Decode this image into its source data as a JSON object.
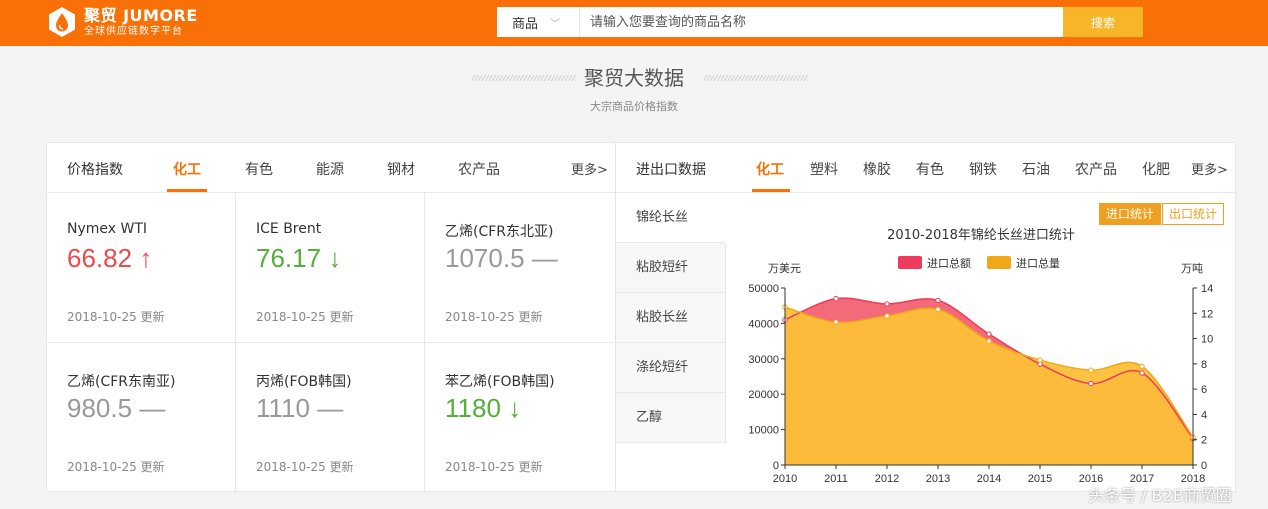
{
  "header": {
    "logo_name": "聚贸 JUMORE",
    "logo_slogan": "全球供应链数字平台",
    "search_category": "商品",
    "search_placeholder": "请输入您要查询的商品名称",
    "search_button": "搜索"
  },
  "section": {
    "title": "聚贸大数据",
    "subtitle": "大宗商品价格指数"
  },
  "price_panel": {
    "title": "价格指数",
    "tabs": [
      "化工",
      "有色",
      "能源",
      "钢材",
      "农产品"
    ],
    "active_tab": "化工",
    "more": "更多>",
    "items": [
      {
        "name": "Nymex WTI",
        "value": "66.82",
        "arrow": "↑",
        "trend": "up",
        "date": "2018-10-25 更新"
      },
      {
        "name": "ICE Brent",
        "value": "76.17",
        "arrow": "↓",
        "trend": "down",
        "date": "2018-10-25 更新"
      },
      {
        "name": "乙烯(CFR东北亚)",
        "value": "1070.5",
        "arrow": "—",
        "trend": "flat",
        "date": "2018-10-25 更新"
      },
      {
        "name": "乙烯(CFR东南亚)",
        "value": "980.5",
        "arrow": "—",
        "trend": "flat",
        "date": "2018-10-25 更新"
      },
      {
        "name": "丙烯(FOB韩国)",
        "value": "1110",
        "arrow": "—",
        "trend": "flat",
        "date": "2018-10-25 更新"
      },
      {
        "name": "苯乙烯(FOB韩国)",
        "value": "1180",
        "arrow": "↓",
        "trend": "down",
        "date": "2018-10-25 更新"
      }
    ]
  },
  "trade_panel": {
    "title": "进出口数据",
    "tabs": [
      "化工",
      "塑料",
      "橡胶",
      "有色",
      "钢铁",
      "石油",
      "农产品",
      "化肥"
    ],
    "active_tab": "化工",
    "more": "更多>",
    "side_items": [
      "锦纶长丝",
      "粘胶短纤",
      "粘胶长丝",
      "涤纶短纤",
      "乙醇"
    ],
    "active_side": "锦纶长丝",
    "toggle_import": "进口统计",
    "toggle_export": "出口统计",
    "toggle_active": "进口统计"
  },
  "chart_data": {
    "type": "area",
    "title": "2010-2018年锦纶长丝进口统计",
    "x": [
      "2010",
      "2011",
      "2012",
      "2013",
      "2014",
      "2015",
      "2016",
      "2017",
      "2018"
    ],
    "series": [
      {
        "name": "进口总额",
        "axis": "left",
        "color": "#ee3b5b",
        "values": [
          41000,
          47000,
          45500,
          46500,
          37000,
          28500,
          23000,
          26000,
          7500
        ]
      },
      {
        "name": "进口总量",
        "axis": "right",
        "color": "#f0a81a",
        "values": [
          12.5,
          11.3,
          11.8,
          12.3,
          9.8,
          8.3,
          7.5,
          7.8,
          2.2
        ]
      }
    ],
    "ylabel_left": "万美元",
    "ylabel_right": "万吨",
    "ylim_left": [
      0,
      50000
    ],
    "ylim_right": [
      0,
      14
    ],
    "yticks_left": [
      0,
      10000,
      20000,
      30000,
      40000,
      50000
    ],
    "yticks_right": [
      0,
      2,
      4,
      6,
      8,
      10,
      12,
      14
    ],
    "legend": "top"
  },
  "watermark": "头条号 / B2B商贸圈",
  "colors": {
    "brand": "#f97007",
    "search_button": "#f7b52a",
    "up": "#e94b4b",
    "down": "#55ad3a",
    "toggle": "#f0a020"
  }
}
